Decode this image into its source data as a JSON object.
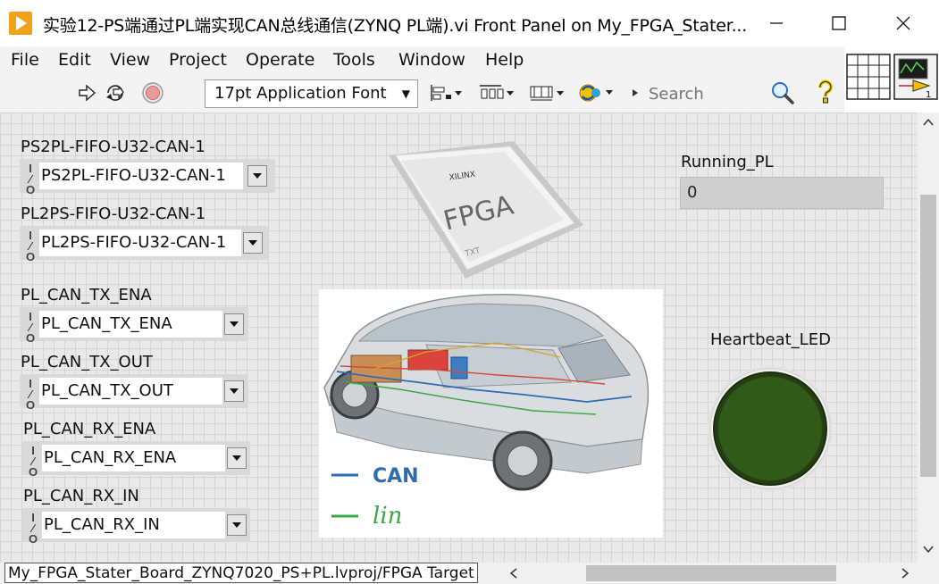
{
  "window": {
    "title": "实验12-PS端通过PL端实现CAN总线通信(ZYNQ PL端).vi Front Panel on My_FPGA_Stater...",
    "minimize_icon": "minimize-icon",
    "maximize_icon": "maximize-icon",
    "close_icon": "close-icon"
  },
  "menu": {
    "items": [
      "File",
      "Edit",
      "View",
      "Project",
      "Operate",
      "Tools",
      "Window",
      "Help"
    ]
  },
  "toolbar": {
    "font": "17pt Application Font",
    "search_placeholder": "Search",
    "icons": [
      "run-arrow-icon",
      "run-continuously-icon",
      "abort-icon",
      "align-objects-icon",
      "distribute-objects-icon",
      "resize-objects-icon",
      "reorder-icon",
      "search-icon",
      "help-icon"
    ]
  },
  "controls": [
    {
      "label": "PS2PL-FIFO-U32-CAN-1",
      "value": "PS2PL-FIFO-U32-CAN-1"
    },
    {
      "label": "PL2PS-FIFO-U32-CAN-1",
      "value": "PL2PS-FIFO-U32-CAN-1"
    },
    {
      "label": "PL_CAN_TX_ENA",
      "value": "PL_CAN_TX_ENA"
    },
    {
      "label": "PL_CAN_TX_OUT",
      "value": "PL_CAN_TX_OUT"
    },
    {
      "label": "PL_CAN_RX_ENA",
      "value": "PL_CAN_RX_ENA"
    },
    {
      "label": "PL_CAN_RX_IN",
      "value": "PL_CAN_RX_IN"
    }
  ],
  "fpga_chip": {
    "text": "FPGA",
    "brand": "XILINX",
    "code": "TXT"
  },
  "running_pl": {
    "label": "Running_PL",
    "value": "0"
  },
  "car_diagram": {
    "legend": [
      {
        "name": "CAN",
        "color": "#2e6bb0"
      },
      {
        "name": "lin",
        "color": "#3aa845"
      }
    ]
  },
  "heartbeat": {
    "label": "Heartbeat_LED",
    "color": "#2f5a17"
  },
  "status": {
    "target": "My_FPGA_Stater_Board_ZYNQ7020_PS+PL.lvproj/FPGA Target"
  }
}
